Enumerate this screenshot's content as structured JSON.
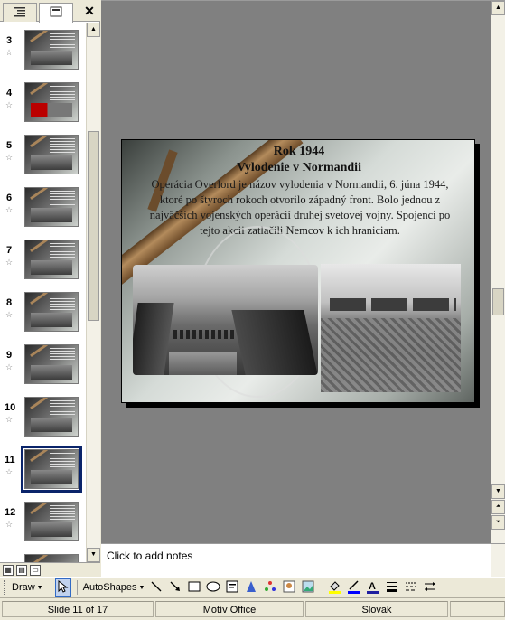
{
  "pane": {
    "tabs": [
      {
        "name": "outline",
        "icon": "outline-tab-icon"
      },
      {
        "name": "slides",
        "icon": "slides-tab-icon"
      }
    ],
    "close_glyph": "✕",
    "thumbnails": [
      {
        "num": "3"
      },
      {
        "num": "4"
      },
      {
        "num": "5"
      },
      {
        "num": "6"
      },
      {
        "num": "7"
      },
      {
        "num": "8"
      },
      {
        "num": "9"
      },
      {
        "num": "10"
      },
      {
        "num": "11"
      },
      {
        "num": "12"
      }
    ],
    "selected_slide": "11"
  },
  "slide": {
    "title_line1": "Rok 1944",
    "title_line2": "Vylodenie v Normandii",
    "body": "Operácia Overlord je názov vylodenia v Normandii, 6. júna 1944, ktoré po štyroch rokoch otvorilo západný front. Bolo jednou z najväčších vojenských operácií druhej svetovej vojny. Spojenci po tejto akcii zatlačili Nemcov k ich hraniciam."
  },
  "notes": {
    "placeholder": "Click to add notes"
  },
  "toolbar": {
    "draw_label": "Draw",
    "autoshapes_label": "AutoShapes",
    "icons": [
      "select-pointer-icon",
      "line-icon",
      "arrow-icon",
      "rectangle-icon",
      "oval-icon",
      "textbox-icon",
      "wordart-icon",
      "diagram-icon",
      "clipart-icon",
      "picture-icon",
      "fill-color-icon",
      "line-color-icon",
      "font-color-icon",
      "line-style-icon",
      "dash-style-icon",
      "arrow-style-icon"
    ]
  },
  "status": {
    "slide_info": "Slide 11 of 17",
    "design": "Motív Office",
    "language": "Slovak"
  },
  "colors": {
    "selection": "#0a246a",
    "workspace": "#808080",
    "chrome": "#ece9d8"
  }
}
